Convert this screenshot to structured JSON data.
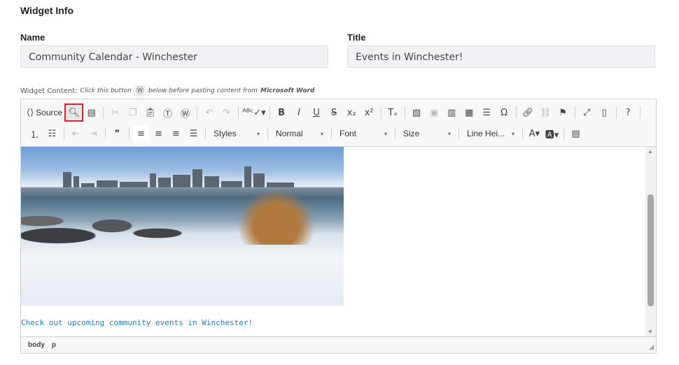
{
  "section_title": "Widget Info",
  "name": {
    "label": "Name",
    "value": "Community Calendar - Winchester"
  },
  "title": {
    "label": "Title",
    "value": "Events in Winchester!"
  },
  "widget_content": {
    "label": "Widget Content:",
    "hint_before": "Click this button",
    "hint_after": "below before pasting content from",
    "hint_bold": "Microsoft Word"
  },
  "toolbar": {
    "row1": [
      {
        "name": "source",
        "glyph": "⟨⟩",
        "label": "Source"
      },
      {
        "name": "preview",
        "glyph": "🔍︎",
        "selected": true
      },
      {
        "name": "templates",
        "glyph": "▤"
      },
      "sep",
      {
        "name": "cut",
        "glyph": "✂",
        "disabled": true
      },
      {
        "name": "copy",
        "glyph": "❐",
        "disabled": true
      },
      {
        "name": "paste",
        "glyph": "📋︎"
      },
      {
        "name": "paste-text",
        "glyph": "Ⓣ"
      },
      {
        "name": "paste-word",
        "glyph": "Ⓦ"
      },
      "sep",
      {
        "name": "undo",
        "glyph": "↶",
        "disabled": true
      },
      {
        "name": "redo",
        "glyph": "↷",
        "disabled": true
      },
      "sep",
      {
        "name": "spellcheck",
        "glyph": "ᴬᴮᶜ✓▾"
      },
      "sep",
      {
        "name": "bold",
        "glyph": "B"
      },
      {
        "name": "italic",
        "glyph": "I"
      },
      {
        "name": "underline",
        "glyph": "U"
      },
      {
        "name": "strikethrough",
        "glyph": "S"
      },
      {
        "name": "subscript",
        "glyph": "x₂"
      },
      {
        "name": "superscript",
        "glyph": "x²"
      },
      "sep",
      {
        "name": "remove-format",
        "glyph": "Tₓ"
      },
      "sep",
      {
        "name": "image",
        "glyph": "▨"
      },
      {
        "name": "flash",
        "glyph": "▣",
        "disabled": true
      },
      {
        "name": "iframe",
        "glyph": "▥"
      },
      {
        "name": "table",
        "glyph": "▦"
      },
      {
        "name": "horizontal-rule",
        "glyph": "☰"
      },
      {
        "name": "special-char",
        "glyph": "Ω"
      },
      "sep",
      {
        "name": "link",
        "glyph": "🔗︎"
      },
      {
        "name": "unlink",
        "glyph": "⛓",
        "disabled": true
      },
      {
        "name": "anchor",
        "glyph": "⚑"
      },
      "sep",
      {
        "name": "maximize",
        "glyph": "⤢"
      },
      {
        "name": "show-blocks",
        "glyph": "▯"
      },
      "sep",
      {
        "name": "help",
        "glyph": "?"
      },
      "sep"
    ],
    "row2a": [
      {
        "name": "numbered-list",
        "glyph": "⒈"
      },
      {
        "name": "bulleted-list",
        "glyph": "☷"
      },
      "sep",
      {
        "name": "outdent",
        "glyph": "⇤",
        "disabled": true
      },
      {
        "name": "indent",
        "glyph": "⇥",
        "disabled": true
      },
      "sep",
      {
        "name": "blockquote",
        "glyph": "❞"
      },
      "sep",
      {
        "name": "align-left",
        "glyph": "≡",
        "white": true
      },
      {
        "name": "align-center",
        "glyph": "≡"
      },
      {
        "name": "align-right",
        "glyph": "≡"
      },
      {
        "name": "justify",
        "glyph": "☰"
      },
      "sep"
    ],
    "combos": [
      {
        "name": "styles",
        "label": "Styles",
        "width": 78
      },
      {
        "name": "format",
        "label": "Normal",
        "width": 80
      },
      {
        "name": "font",
        "label": "Font",
        "width": 80
      },
      {
        "name": "size",
        "label": "Size",
        "width": 80
      },
      {
        "name": "line-height",
        "label": "Line Hei...",
        "width": 80
      }
    ],
    "row2b": [
      {
        "name": "text-color",
        "glyph": "A▾"
      },
      {
        "name": "background-color",
        "glyph": "🅰▾"
      },
      "sep",
      {
        "name": "document",
        "glyph": "▤"
      }
    ]
  },
  "content_text": "Check out upcoming community events in Winchester!",
  "status_path": [
    "body",
    "p"
  ]
}
